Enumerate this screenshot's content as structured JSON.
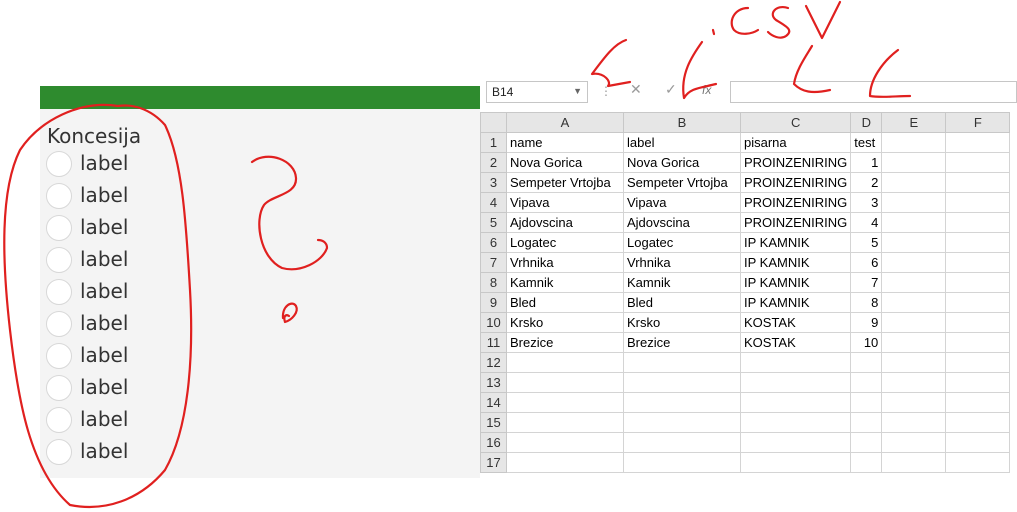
{
  "app": {
    "group_title": "Koncesija",
    "header_color": "#2e8b2e",
    "radio_options": [
      {
        "label": "label",
        "checked": false
      },
      {
        "label": "label",
        "checked": false
      },
      {
        "label": "label",
        "checked": false
      },
      {
        "label": "label",
        "checked": false
      },
      {
        "label": "label",
        "checked": false
      },
      {
        "label": "label",
        "checked": false
      },
      {
        "label": "label",
        "checked": false
      },
      {
        "label": "label",
        "checked": false
      },
      {
        "label": "label",
        "checked": false
      },
      {
        "label": "label",
        "checked": false
      }
    ]
  },
  "spreadsheet": {
    "name_box": "B14",
    "formula_buttons": {
      "cancel": "✕",
      "enter": "✓",
      "fx": "fx"
    },
    "formula_value": "",
    "columns": [
      "A",
      "B",
      "C",
      "D",
      "E",
      "F"
    ],
    "rows": [
      {
        "n": "1",
        "cells": [
          "name",
          "label",
          "pisarna",
          "test",
          "",
          ""
        ]
      },
      {
        "n": "2",
        "cells": [
          "Nova Gorica",
          "Nova Gorica",
          "PROINZENIRING",
          "1",
          "",
          ""
        ]
      },
      {
        "n": "3",
        "cells": [
          "Sempeter Vrtojba",
          "Sempeter Vrtojba",
          "PROINZENIRING",
          "2",
          "",
          ""
        ]
      },
      {
        "n": "4",
        "cells": [
          "Vipava",
          "Vipava",
          "PROINZENIRING",
          "3",
          "",
          ""
        ]
      },
      {
        "n": "5",
        "cells": [
          "Ajdovscina",
          "Ajdovscina",
          "PROINZENIRING",
          "4",
          "",
          ""
        ]
      },
      {
        "n": "6",
        "cells": [
          "Logatec",
          "Logatec",
          "IP KAMNIK",
          "5",
          "",
          ""
        ]
      },
      {
        "n": "7",
        "cells": [
          "Vrhnika",
          "Vrhnika",
          "IP KAMNIK",
          "6",
          "",
          ""
        ]
      },
      {
        "n": "8",
        "cells": [
          "Kamnik",
          "Kamnik",
          "IP KAMNIK",
          "7",
          "",
          ""
        ]
      },
      {
        "n": "9",
        "cells": [
          "Bled",
          "Bled",
          "IP KAMNIK",
          "8",
          "",
          ""
        ]
      },
      {
        "n": "10",
        "cells": [
          "Krsko",
          "Krsko",
          "KOSTAK",
          "9",
          "",
          ""
        ]
      },
      {
        "n": "11",
        "cells": [
          "Brezice",
          "Brezice",
          "KOSTAK",
          "10",
          "",
          ""
        ]
      },
      {
        "n": "12",
        "cells": [
          "",
          "",
          "",
          "",
          "",
          ""
        ]
      },
      {
        "n": "13",
        "cells": [
          "",
          "",
          "",
          "",
          "",
          ""
        ]
      },
      {
        "n": "14",
        "cells": [
          "",
          "",
          "",
          "",
          "",
          ""
        ]
      },
      {
        "n": "15",
        "cells": [
          "",
          "",
          "",
          "",
          "",
          ""
        ]
      },
      {
        "n": "16",
        "cells": [
          "",
          "",
          "",
          "",
          "",
          ""
        ]
      },
      {
        "n": "17",
        "cells": [
          "",
          "",
          "",
          "",
          "",
          ""
        ]
      }
    ]
  },
  "annotations": {
    "handwriting_text": "CSV",
    "color": "#e0201f"
  }
}
